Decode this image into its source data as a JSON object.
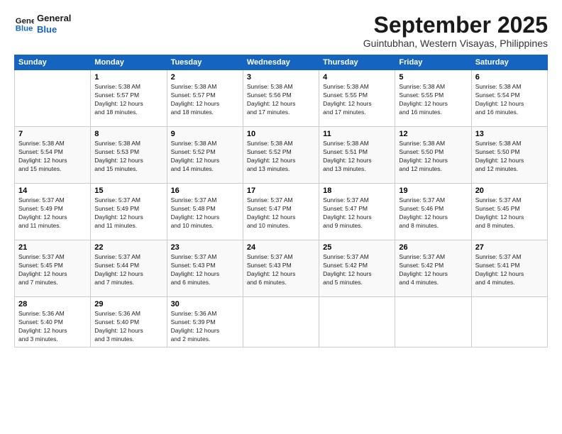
{
  "logo": {
    "line1": "General",
    "line2": "Blue"
  },
  "title": "September 2025",
  "location": "Guintubhan, Western Visayas, Philippines",
  "days_of_week": [
    "Sunday",
    "Monday",
    "Tuesday",
    "Wednesday",
    "Thursday",
    "Friday",
    "Saturday"
  ],
  "weeks": [
    [
      {
        "day": "",
        "info": ""
      },
      {
        "day": "1",
        "info": "Sunrise: 5:38 AM\nSunset: 5:57 PM\nDaylight: 12 hours\nand 18 minutes."
      },
      {
        "day": "2",
        "info": "Sunrise: 5:38 AM\nSunset: 5:57 PM\nDaylight: 12 hours\nand 18 minutes."
      },
      {
        "day": "3",
        "info": "Sunrise: 5:38 AM\nSunset: 5:56 PM\nDaylight: 12 hours\nand 17 minutes."
      },
      {
        "day": "4",
        "info": "Sunrise: 5:38 AM\nSunset: 5:55 PM\nDaylight: 12 hours\nand 17 minutes."
      },
      {
        "day": "5",
        "info": "Sunrise: 5:38 AM\nSunset: 5:55 PM\nDaylight: 12 hours\nand 16 minutes."
      },
      {
        "day": "6",
        "info": "Sunrise: 5:38 AM\nSunset: 5:54 PM\nDaylight: 12 hours\nand 16 minutes."
      }
    ],
    [
      {
        "day": "7",
        "info": "Sunrise: 5:38 AM\nSunset: 5:54 PM\nDaylight: 12 hours\nand 15 minutes."
      },
      {
        "day": "8",
        "info": "Sunrise: 5:38 AM\nSunset: 5:53 PM\nDaylight: 12 hours\nand 15 minutes."
      },
      {
        "day": "9",
        "info": "Sunrise: 5:38 AM\nSunset: 5:52 PM\nDaylight: 12 hours\nand 14 minutes."
      },
      {
        "day": "10",
        "info": "Sunrise: 5:38 AM\nSunset: 5:52 PM\nDaylight: 12 hours\nand 13 minutes."
      },
      {
        "day": "11",
        "info": "Sunrise: 5:38 AM\nSunset: 5:51 PM\nDaylight: 12 hours\nand 13 minutes."
      },
      {
        "day": "12",
        "info": "Sunrise: 5:38 AM\nSunset: 5:50 PM\nDaylight: 12 hours\nand 12 minutes."
      },
      {
        "day": "13",
        "info": "Sunrise: 5:38 AM\nSunset: 5:50 PM\nDaylight: 12 hours\nand 12 minutes."
      }
    ],
    [
      {
        "day": "14",
        "info": "Sunrise: 5:37 AM\nSunset: 5:49 PM\nDaylight: 12 hours\nand 11 minutes."
      },
      {
        "day": "15",
        "info": "Sunrise: 5:37 AM\nSunset: 5:49 PM\nDaylight: 12 hours\nand 11 minutes."
      },
      {
        "day": "16",
        "info": "Sunrise: 5:37 AM\nSunset: 5:48 PM\nDaylight: 12 hours\nand 10 minutes."
      },
      {
        "day": "17",
        "info": "Sunrise: 5:37 AM\nSunset: 5:47 PM\nDaylight: 12 hours\nand 10 minutes."
      },
      {
        "day": "18",
        "info": "Sunrise: 5:37 AM\nSunset: 5:47 PM\nDaylight: 12 hours\nand 9 minutes."
      },
      {
        "day": "19",
        "info": "Sunrise: 5:37 AM\nSunset: 5:46 PM\nDaylight: 12 hours\nand 8 minutes."
      },
      {
        "day": "20",
        "info": "Sunrise: 5:37 AM\nSunset: 5:45 PM\nDaylight: 12 hours\nand 8 minutes."
      }
    ],
    [
      {
        "day": "21",
        "info": "Sunrise: 5:37 AM\nSunset: 5:45 PM\nDaylight: 12 hours\nand 7 minutes."
      },
      {
        "day": "22",
        "info": "Sunrise: 5:37 AM\nSunset: 5:44 PM\nDaylight: 12 hours\nand 7 minutes."
      },
      {
        "day": "23",
        "info": "Sunrise: 5:37 AM\nSunset: 5:43 PM\nDaylight: 12 hours\nand 6 minutes."
      },
      {
        "day": "24",
        "info": "Sunrise: 5:37 AM\nSunset: 5:43 PM\nDaylight: 12 hours\nand 6 minutes."
      },
      {
        "day": "25",
        "info": "Sunrise: 5:37 AM\nSunset: 5:42 PM\nDaylight: 12 hours\nand 5 minutes."
      },
      {
        "day": "26",
        "info": "Sunrise: 5:37 AM\nSunset: 5:42 PM\nDaylight: 12 hours\nand 4 minutes."
      },
      {
        "day": "27",
        "info": "Sunrise: 5:37 AM\nSunset: 5:41 PM\nDaylight: 12 hours\nand 4 minutes."
      }
    ],
    [
      {
        "day": "28",
        "info": "Sunrise: 5:36 AM\nSunset: 5:40 PM\nDaylight: 12 hours\nand 3 minutes."
      },
      {
        "day": "29",
        "info": "Sunrise: 5:36 AM\nSunset: 5:40 PM\nDaylight: 12 hours\nand 3 minutes."
      },
      {
        "day": "30",
        "info": "Sunrise: 5:36 AM\nSunset: 5:39 PM\nDaylight: 12 hours\nand 2 minutes."
      },
      {
        "day": "",
        "info": ""
      },
      {
        "day": "",
        "info": ""
      },
      {
        "day": "",
        "info": ""
      },
      {
        "day": "",
        "info": ""
      }
    ]
  ]
}
